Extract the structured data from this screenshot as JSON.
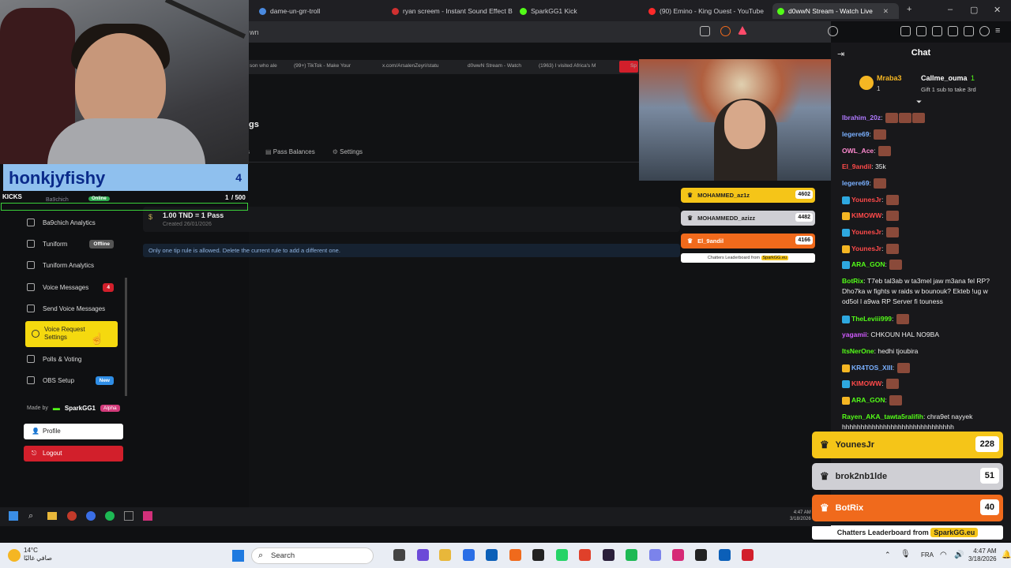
{
  "browser": {
    "tabs": [
      {
        "label": "dame-un-grr-troll",
        "color": "#4a8ae0"
      },
      {
        "label": "ryan screem - Instant Sound Effect B",
        "color": "#d03030"
      },
      {
        "label": "SparkGG1 Kick",
        "color": "#53fc18"
      },
      {
        "label": "(90) Emino - King Ouest - YouTube",
        "color": "#ff2a2a"
      },
      {
        "label": "d0wwN Stream - Watch Live",
        "color": "#53fc18",
        "active": true
      }
    ],
    "address_partial": "wn"
  },
  "inner_tabs": [
    "son who ale",
    "(99+) TikTok - Make Your",
    "x.com/ArsalenZeyri/statu",
    "d0wwN Stream - Watch",
    "(1963) I visited Africa's M",
    "Sp"
  ],
  "streamer_overlay": {
    "name": "honkjyfishy",
    "count": "4",
    "kicks_label": "KICKS",
    "goal_current": "1",
    "goal_total": "/ 500",
    "partial_row_label": "Ba9chich",
    "partial_row_badge": "Online"
  },
  "sidebar": {
    "items": [
      {
        "label": "Ba9chich Analytics",
        "badge": ""
      },
      {
        "label": "Tuniform",
        "badge": "Offline"
      },
      {
        "label": "Tuniform Analytics",
        "badge": ""
      },
      {
        "label": "Voice Messages",
        "badge": "4"
      },
      {
        "label": "Send Voice Messages",
        "badge": ""
      },
      {
        "label": "Voice Request Settings",
        "badge": ""
      },
      {
        "label": "Polls & Voting",
        "badge": ""
      },
      {
        "label": "OBS Setup",
        "badge": "New"
      }
    ],
    "made_by": "Made by",
    "brand": "SparkGG1",
    "alpha": "Alpha",
    "profile": "Profile",
    "logout": "Logout"
  },
  "main": {
    "header_partial": "gs",
    "subnav_partial": "s",
    "subnav": [
      "Pass Balances",
      "Settings"
    ],
    "rule_title": "1.00 TND = 1 Pass",
    "rule_created": "Created 26/01/2026",
    "note": "Only one tip rule is allowed. Delete the current rule to add a different one."
  },
  "mini_leaderboard": {
    "rows": [
      {
        "name": "MOHAMMED_az1z",
        "score": "4602",
        "color": "#f5c518",
        "text": "#222"
      },
      {
        "name": "MOHAMMEDD_azizz",
        "score": "4482",
        "color": "#cfcfd4",
        "text": "#222"
      },
      {
        "name": "El_9andil",
        "score": "4166",
        "color": "#f06a1c",
        "text": "#fff"
      }
    ],
    "footer": "Chatters Leaderboard from",
    "footer_brand": "SparkGG.eu"
  },
  "chat": {
    "title": "Chat",
    "pinned": {
      "user1": "Mraba3",
      "user1_count": "1",
      "user2": "Callme_ouma",
      "user2_count": "1",
      "gift": "Gift 1 sub to take 3rd"
    },
    "messages": [
      {
        "user": "Ibrahim_20z",
        "color": "#b07aff",
        "text": "",
        "emotes": 3
      },
      {
        "user": "legere69",
        "color": "#7ab0ff",
        "text": "",
        "emotes": 1
      },
      {
        "user": "OWL_Ace",
        "color": "#ff8ad0",
        "text": "",
        "emotes": 1
      },
      {
        "user": "El_9andil",
        "color": "#ff4a4a",
        "text": "35k",
        "emotes": 0
      },
      {
        "user": "legere69",
        "color": "#7ab0ff",
        "text": "",
        "emotes": 1
      },
      {
        "user": "YounesJr",
        "color": "#ff4a4a",
        "text": "",
        "emotes": 1
      },
      {
        "user": "KIMOWW",
        "color": "#ff4a4a",
        "text": "",
        "emotes": 1
      },
      {
        "user": "YounesJr",
        "color": "#ff4a4a",
        "text": "",
        "emotes": 1
      },
      {
        "user": "YounesJr",
        "color": "#ff4a4a",
        "text": "",
        "emotes": 1
      },
      {
        "user": "ARA_GON",
        "color": "#53fc18",
        "text": "",
        "emotes": 1
      },
      {
        "user": "BotRix",
        "color": "#53fc18",
        "text": "T7eb tal3ab w ta3mel jaw m3ana fel RP? Dho7ka w fights w raids w bounouk? Ekteb !ug w od5ol l a9wa RP Server fi touness",
        "emotes": 0
      },
      {
        "user": "TheLeviii999",
        "color": "#53fc18",
        "text": "",
        "emotes": 1
      },
      {
        "user": "yagamii",
        "color": "#d05aff",
        "text": "CHKOUN HAL NO9BA",
        "emotes": 0
      },
      {
        "user": "ItsNerOne",
        "color": "#53fc18",
        "text": "hedhi tjoubira",
        "emotes": 0
      },
      {
        "user": "KR4TOS_XIII",
        "color": "#7ab0ff",
        "text": "",
        "emotes": 1
      },
      {
        "user": "KIMOWW",
        "color": "#ff4a4a",
        "text": "",
        "emotes": 1
      },
      {
        "user": "ARA_GON",
        "color": "#53fc18",
        "text": "",
        "emotes": 1
      },
      {
        "user": "Rayen_AKA_tawta5ralifih",
        "color": "#53fc18",
        "text": "chra9et nayyek hhhhhhhhhhhhhhhhhhhhhhhhhhhhhh",
        "emotes": 0
      }
    ]
  },
  "big_leaderboard": {
    "rows": [
      {
        "name": "YounesJr",
        "score": "228",
        "color": "#f5c518",
        "text": "#222"
      },
      {
        "name": "brok2nb1lde",
        "score": "51",
        "color": "#cfcfd4",
        "text": "#222"
      },
      {
        "name": "BotRix",
        "score": "40",
        "color": "#f06a1c",
        "text": "#fff"
      }
    ],
    "footer": "Chatters Leaderboard from",
    "footer_brand": "SparkGG.eu"
  },
  "inner_clock": {
    "time": "4:47 AM",
    "date": "3/18/2026"
  },
  "taskbar": {
    "temp": "14°C",
    "weather": "صافي غالبًا",
    "search": "Search",
    "lang": "FRA",
    "time": "4:47 AM",
    "date": "3/18/2026"
  }
}
